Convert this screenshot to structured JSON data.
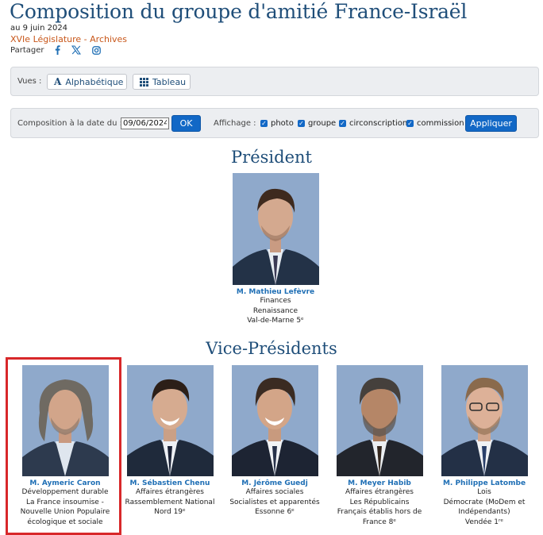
{
  "header": {
    "title": "Composition du groupe d'amitié France-Israël",
    "date": "au 9 juin 2024",
    "legislature": "XVIe Législature - Archives",
    "share_label": "Partager",
    "share_icons": [
      "facebook-icon",
      "x-icon",
      "instagram-icon"
    ]
  },
  "views": {
    "label": "Vues :",
    "alphabetic": "Alphabétique",
    "table": "Tableau"
  },
  "composition": {
    "date_label": "Composition à la date du :",
    "date_value": "09/06/2024",
    "ok_label": "OK",
    "display_label": "Affichage :",
    "options": [
      "photo",
      "groupe",
      "circonscription",
      "commission"
    ],
    "apply_label": "Appliquer"
  },
  "colors": {
    "title": "#1f4e79",
    "link": "#1f6fb5",
    "accent_orange": "#c8571a",
    "primary_button": "#1268c6",
    "highlight": "#d8282a"
  },
  "president": {
    "heading": "Président",
    "members": [
      {
        "name": "M. Mathieu Lefèvre",
        "lines": [
          "Finances",
          "Renaissance",
          "Val-de-Marne 5ᵉ"
        ]
      }
    ]
  },
  "vice_presidents": {
    "heading": "Vice-Présidents",
    "members": [
      {
        "name": "M. Aymeric Caron",
        "lines": [
          "Développement durable",
          "La France insoumise - Nouvelle Union Populaire écologique et sociale"
        ]
      },
      {
        "name": "M. Sébastien Chenu",
        "lines": [
          "Affaires étrangères",
          "Rassemblement National",
          "Nord 19ᵉ"
        ]
      },
      {
        "name": "M. Jérôme Guedj",
        "lines": [
          "Affaires sociales",
          "Socialistes et apparentés",
          "Essonne 6ᵉ"
        ]
      },
      {
        "name": "M. Meyer Habib",
        "lines": [
          "Affaires étrangères",
          "Les Républicains",
          "Français établis hors de France 8ᵉ"
        ]
      },
      {
        "name": "M. Philippe Latombe",
        "lines": [
          "Lois",
          "Démocrate (MoDem et Indépendants)",
          "Vendée 1ʳᵉ"
        ]
      }
    ]
  }
}
